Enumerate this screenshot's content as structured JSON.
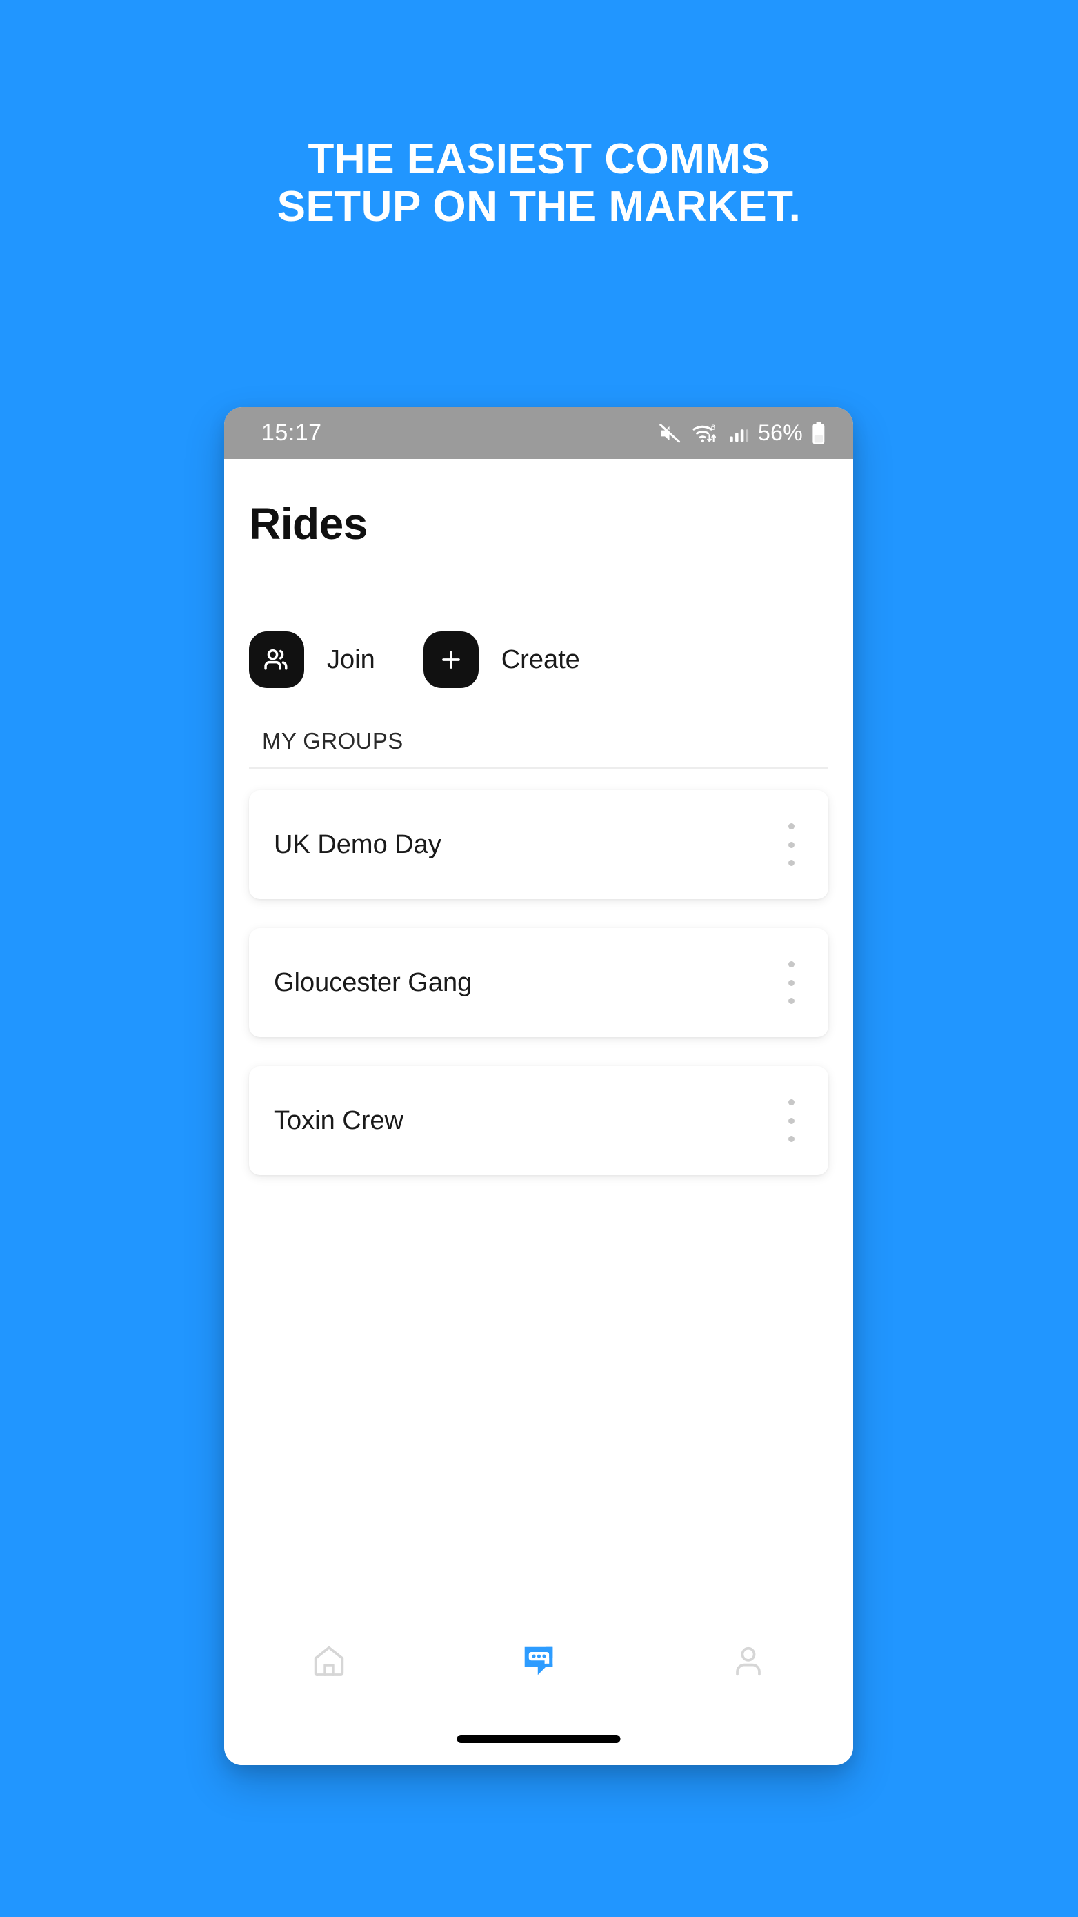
{
  "promo": {
    "headline_line1": "THE EASIEST COMMS",
    "headline_line2": "SETUP ON THE MARKET.",
    "background_color": "#2196FF",
    "headline_color": "#FFFFFF"
  },
  "status_bar": {
    "time": "15:17",
    "battery_percent": "56%",
    "background_color": "#9B9B9B",
    "icons": [
      "mute-icon",
      "wifi-6-icon",
      "cellular-signal-icon",
      "battery-icon"
    ]
  },
  "screen": {
    "title": "Rides",
    "actions": [
      {
        "icon": "people-icon",
        "label": "Join"
      },
      {
        "icon": "plus-icon",
        "label": "Create"
      }
    ],
    "section_label": "MY GROUPS",
    "groups": [
      {
        "name": "UK Demo Day",
        "menu_icon": "kebab-menu-icon"
      },
      {
        "name": "Gloucester Gang",
        "menu_icon": "kebab-menu-icon"
      },
      {
        "name": "Toxin Crew",
        "menu_icon": "kebab-menu-icon"
      }
    ],
    "bottom_nav": [
      {
        "icon": "home-icon",
        "active": false,
        "color": "#D4D4D4"
      },
      {
        "icon": "chat-bubble-icon",
        "active": true,
        "color": "#2D9CFF"
      },
      {
        "icon": "profile-icon",
        "active": false,
        "color": "#D4D4D4"
      }
    ],
    "accent_color": "#2D9CFF",
    "button_color": "#111111"
  }
}
